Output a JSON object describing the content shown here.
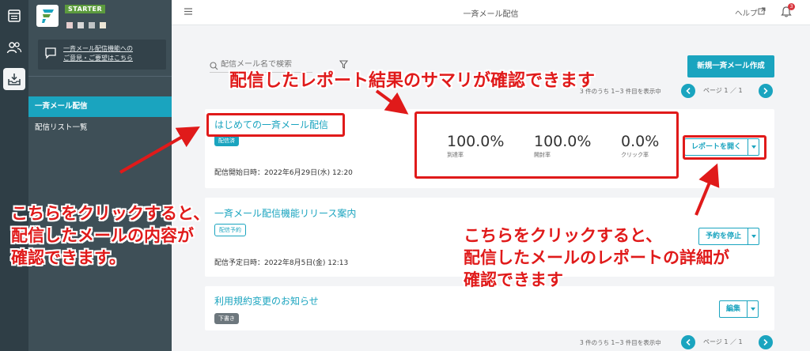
{
  "app": {
    "plan_badge": "STARTER",
    "feedback": "一斉メール配信機能への\nご意見・ご要望はこちら",
    "nav": [
      {
        "label": "一斉メール配信"
      },
      {
        "label": "配信リスト一覧"
      }
    ],
    "colors": {
      "accent": "#1aa4bf",
      "sidebar": "#3e4f57",
      "rail": "#2f3e46",
      "annotation": "#e01a1a"
    }
  },
  "topbar": {
    "title": "一斉メール配信",
    "help": "ヘルプ",
    "notification_count": "3"
  },
  "toolbar": {
    "search_placeholder": "配信メール名で検索",
    "new_button": "新規一斉メール作成",
    "count_text": "3 件のうち 1~3 件目を表示中",
    "page_text": "ページ 1 ／ 1"
  },
  "mails": [
    {
      "title": "はじめての一斉メール配信",
      "status": "配信済",
      "date": "配信開始日時：2022年6月29日(水) 12:20",
      "stats": [
        {
          "value": "100.0%",
          "label": "到達率"
        },
        {
          "value": "100.0%",
          "label": "開封率"
        },
        {
          "value": "0.0%",
          "label": "クリック率"
        }
      ],
      "action": "レポートを開く"
    },
    {
      "title": "一斉メール配信機能リリース案内",
      "status": "配信予約",
      "date": "配信予定日時：2022年8月5日(金) 12:13",
      "action": "予約を停止"
    },
    {
      "title": "利用規約変更のお知らせ",
      "status": "下書き",
      "action": "編集"
    }
  ],
  "annotations": {
    "summary": "配信したレポート結果のサマリが確認できます",
    "left": "こちらをクリックすると、\n配信したメールの内容が\n確認できます。",
    "right": "こちらをクリックすると、\n配信したメールのレポートの詳細が\n確認できます"
  }
}
